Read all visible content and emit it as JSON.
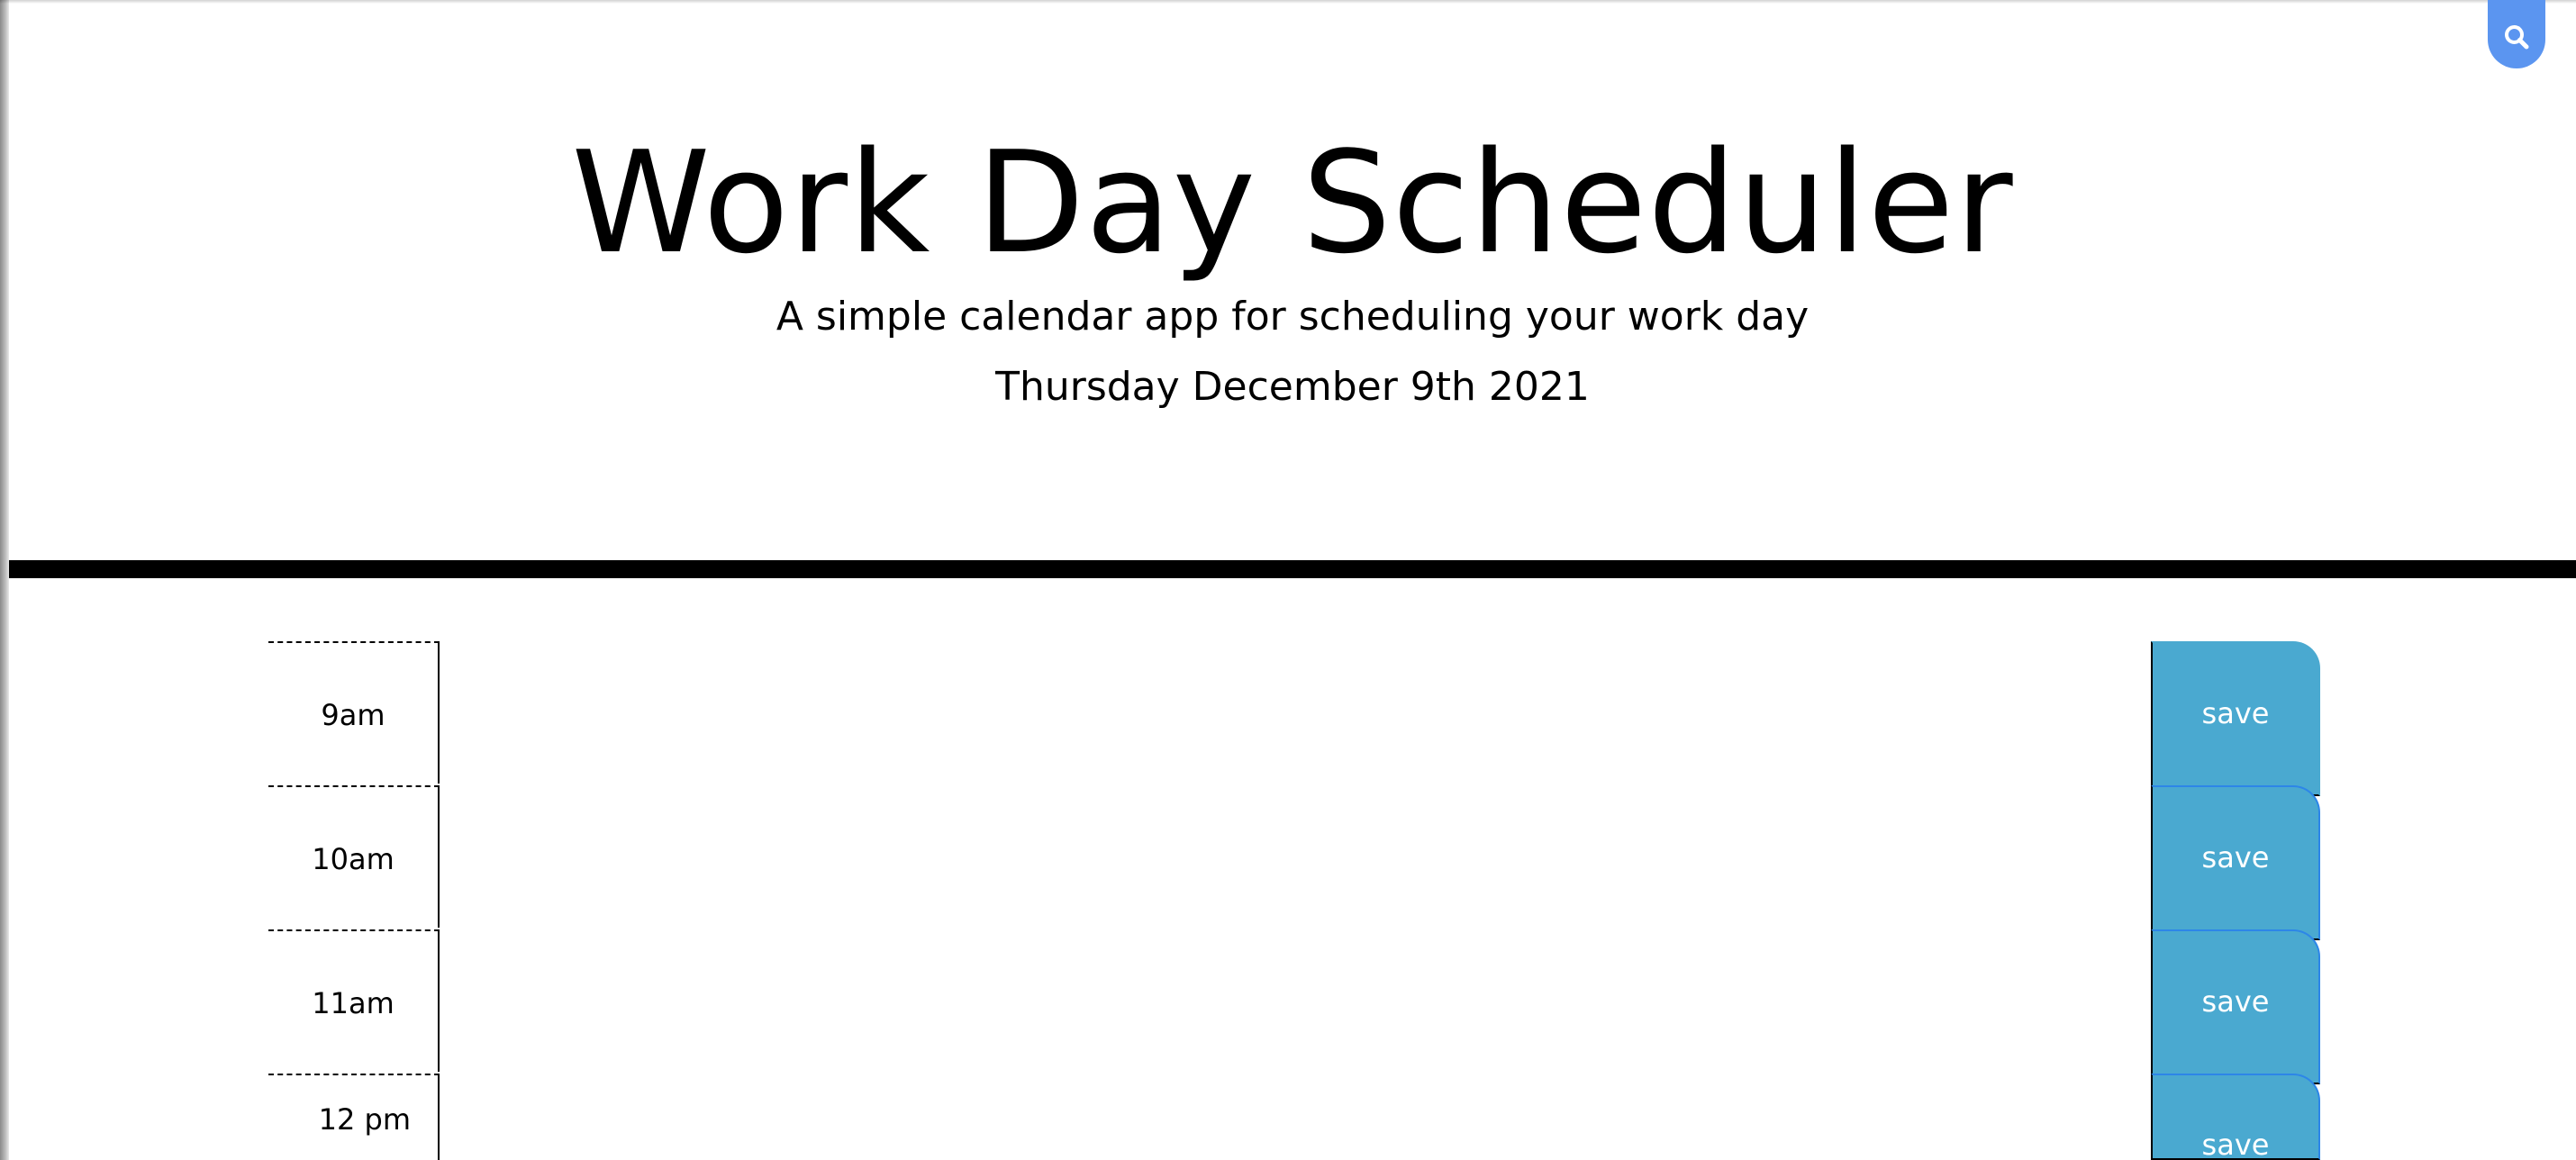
{
  "header": {
    "title": "Work Day Scheduler",
    "subtitle": "A simple calendar app for scheduling your work day",
    "current_day": "Thursday December 9th 2021"
  },
  "search_tab": {
    "icon": "search-icon",
    "color": "#5b95f0"
  },
  "time_blocks": [
    {
      "hour": "9am",
      "description": "",
      "save_label": "save"
    },
    {
      "hour": "10am",
      "description": "",
      "save_label": "save"
    },
    {
      "hour": "11am",
      "description": "",
      "save_label": "save"
    },
    {
      "hour": "12 pm",
      "description": "",
      "save_label": "save"
    }
  ],
  "colors": {
    "save_button": "#4aa9d0",
    "save_text": "#ffffff",
    "divider": "#000000"
  }
}
